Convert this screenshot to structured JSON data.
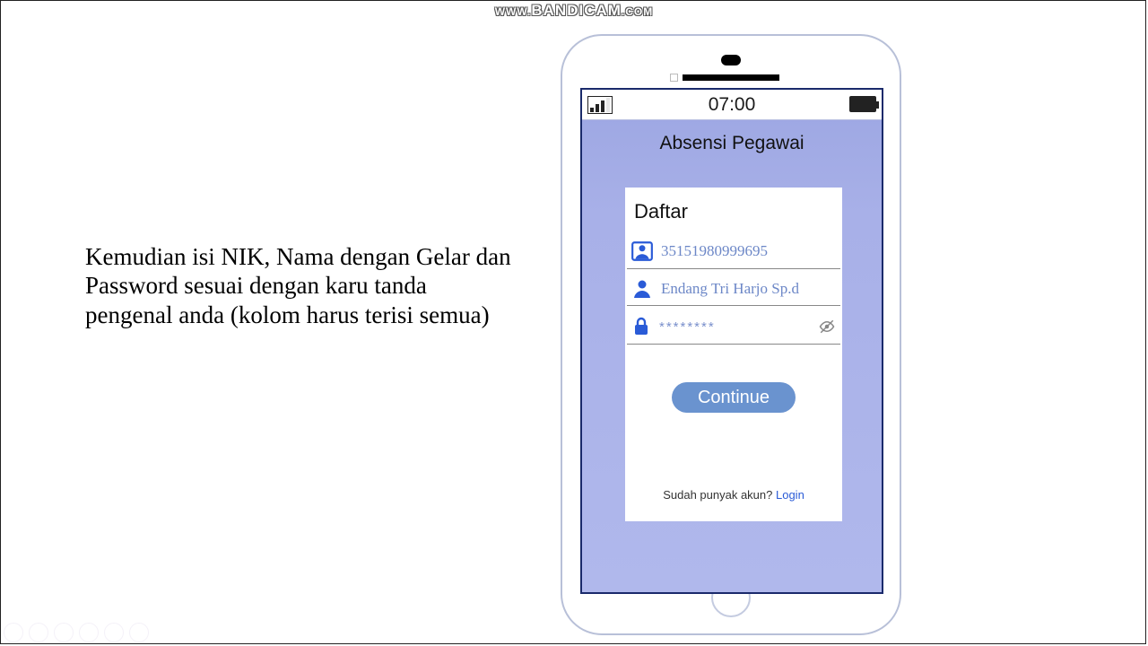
{
  "watermark": "WWW.BANDICAM.COM",
  "instruction_text": "Kemudian isi NIK, Nama dengan Gelar dan Password sesuai dengan karu tanda pengenal anda (kolom harus terisi semua)",
  "status": {
    "time": "07:00"
  },
  "app": {
    "title": "Absensi Pegawai"
  },
  "form": {
    "title": "Daftar",
    "nik_value": "35151980999695",
    "name_value": "Endang Tri Harjo Sp.d",
    "password_masked": "********",
    "continue_label": "Continue",
    "footer_prompt": "Sudah punyak akun? ",
    "footer_link": "Login"
  }
}
